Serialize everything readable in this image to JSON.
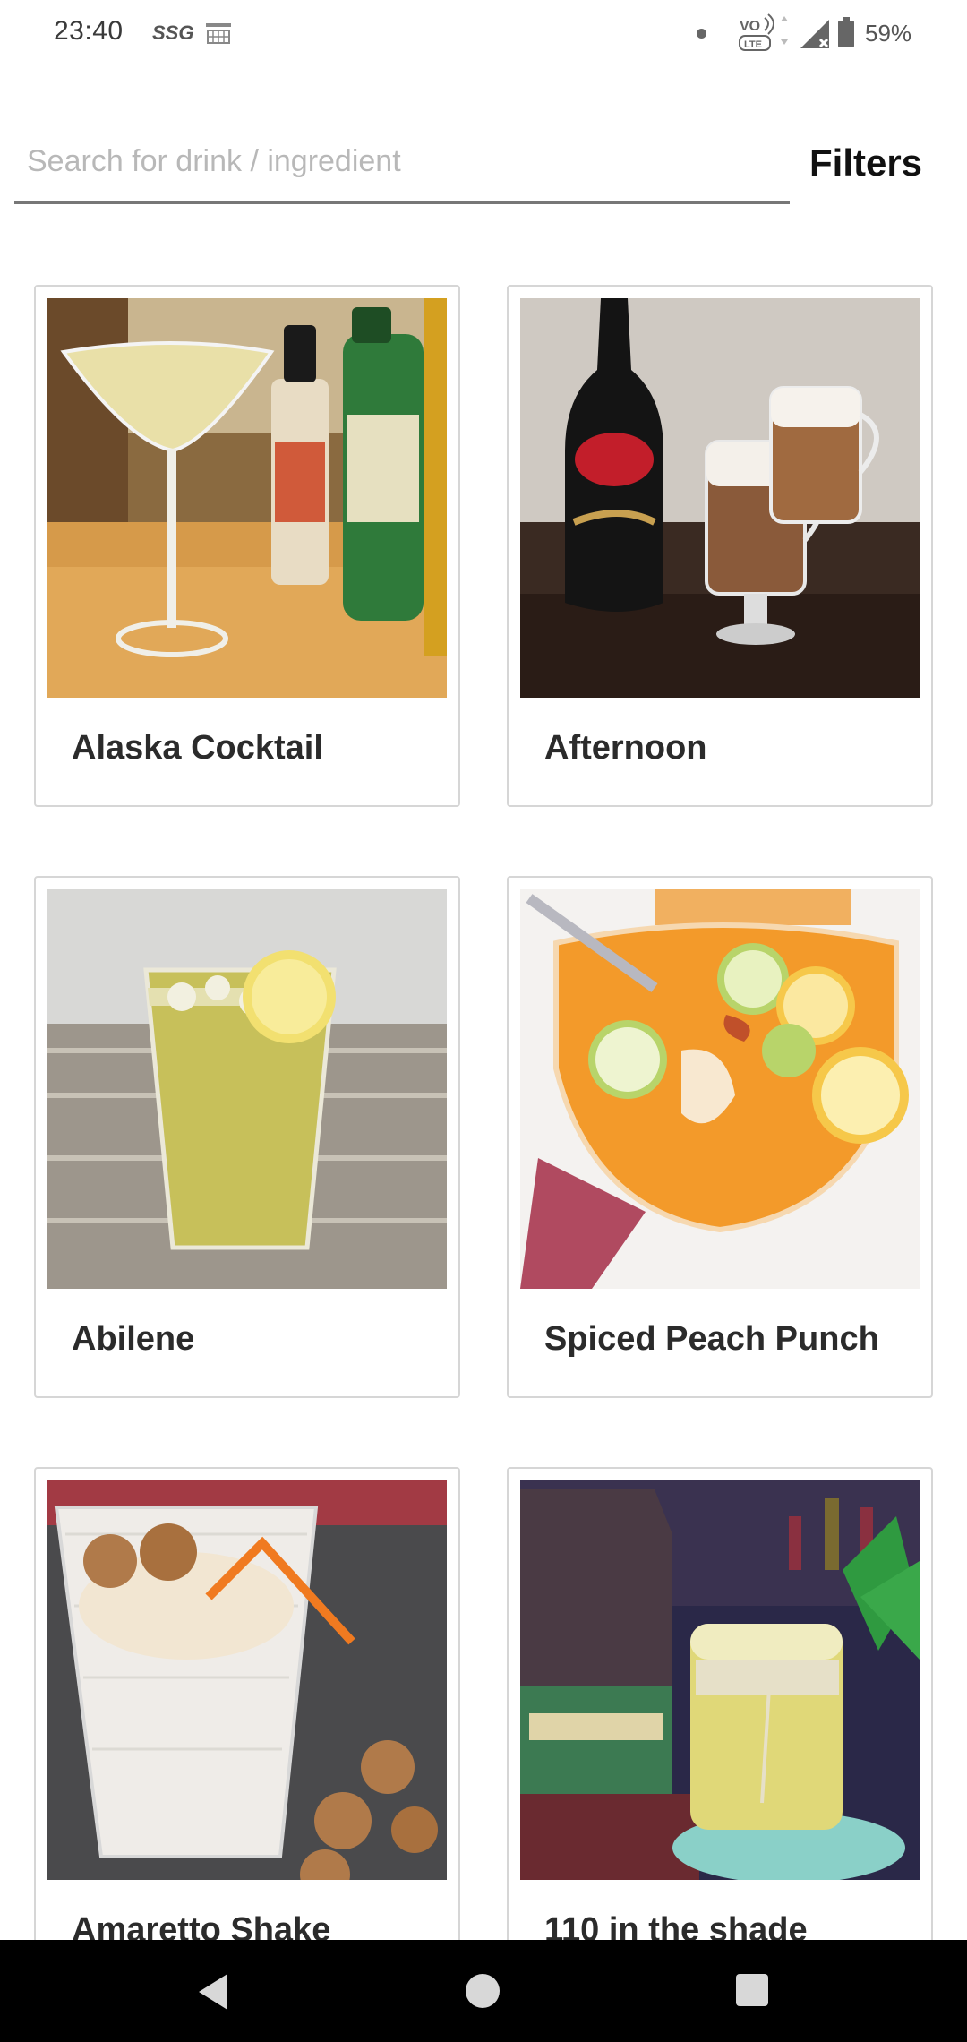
{
  "status_bar": {
    "time": "23:40",
    "carrier_icon_text": "SSG",
    "battery_percent": "59%"
  },
  "search": {
    "placeholder": "Search for drink / ingredient",
    "value": ""
  },
  "filters_label": "Filters",
  "drinks": [
    {
      "name": "Alaska Cocktail",
      "image": "martini-glass-with-bottles"
    },
    {
      "name": "Afternoon",
      "image": "baileys-bottle-with-coffee-mugs"
    },
    {
      "name": "Abilene",
      "image": "iced-lemonade-glass"
    },
    {
      "name": "Spiced Peach Punch",
      "image": "punch-bowl-with-citrus"
    },
    {
      "name": "Amaretto Shake",
      "image": "milkshake-with-cookies"
    },
    {
      "name": "110 in the shade",
      "image": "whiskey-bottle-and-glass"
    }
  ],
  "colors": {
    "card_border": "#d6d6d6",
    "search_underline": "#777777",
    "nav_bar": "#000000"
  }
}
